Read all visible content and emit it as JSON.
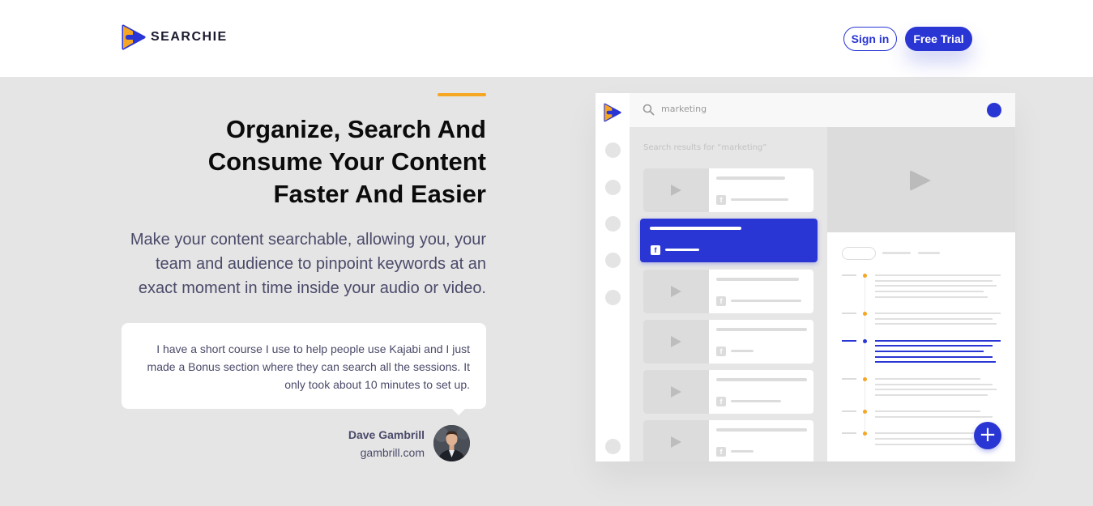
{
  "header": {
    "brand": "SEARCHIE",
    "signin_label": "Sign in",
    "trial_label": "Free Trial"
  },
  "hero": {
    "title_lines": [
      "Organize, Search And",
      "Consume Your Content",
      "Faster And Easier"
    ],
    "subtitle_lines": [
      "Make your content searchable, allowing you, your",
      "team and audience to pinpoint keywords at an",
      "exact moment in time inside your audio or video."
    ]
  },
  "testimonial": {
    "quote_lines": [
      "I have a short course I use to help people use Kajabi and I just",
      "made a Bonus section where they can search all the sessions. It",
      "only took about 10 minutes to set up."
    ],
    "author": "Dave Gambrill",
    "site": "gambrill.com"
  },
  "mockup": {
    "search_query": "marketing",
    "results_label": "Search results for “marketing”",
    "fb_glyph": "f",
    "fab_glyph": "+"
  },
  "colors": {
    "brand_blue": "#2a36d4",
    "accent_orange": "#f5a623",
    "page_bg": "#e5e5e5"
  }
}
